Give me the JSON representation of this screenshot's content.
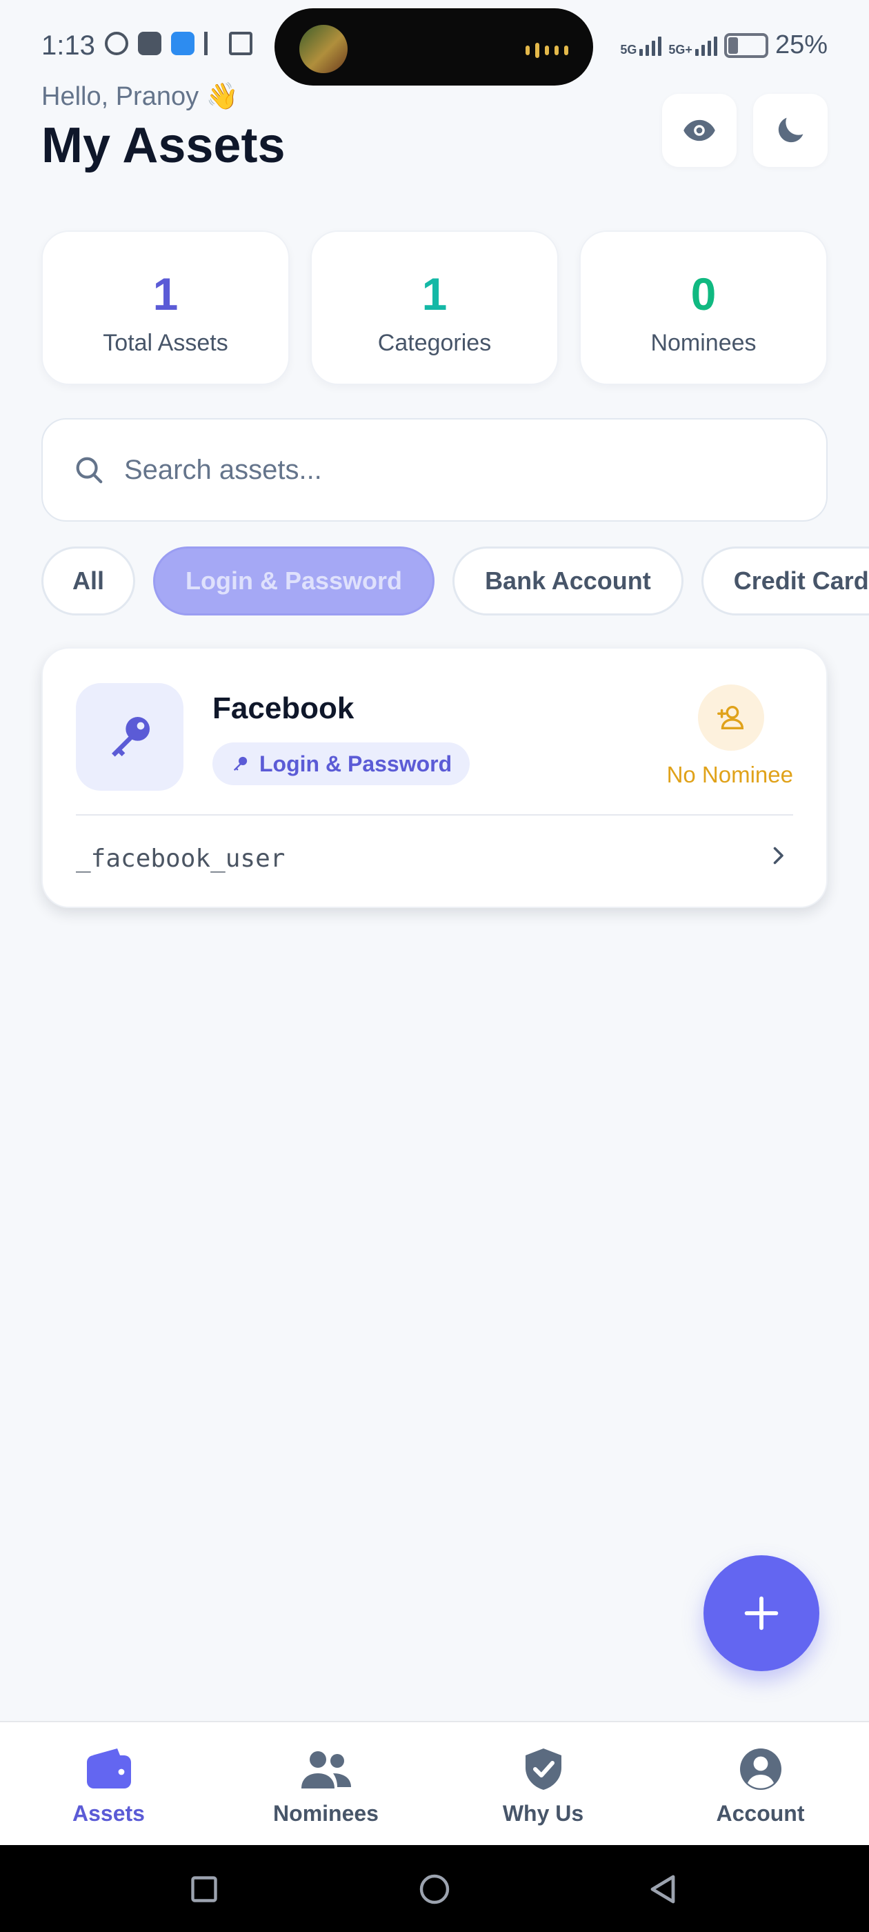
{
  "status_bar": {
    "time": "1:13",
    "network_1": "5G",
    "network_2": "5G+",
    "battery": "25%",
    "notification_icons": [
      "whatsapp-icon",
      "gmail-icon",
      "app-icon",
      "phonepe-icon",
      "mail-icon"
    ]
  },
  "header": {
    "greeting": "Hello, Pranoy 👋",
    "title": "My Assets",
    "actions": [
      "eye-icon",
      "moon-icon"
    ]
  },
  "stats": [
    {
      "value": "1",
      "label": "Total Assets",
      "color": "#5b5bd6"
    },
    {
      "value": "1",
      "label": "Categories",
      "color": "#14b8a6"
    },
    {
      "value": "0",
      "label": "Nominees",
      "color": "#10b981"
    }
  ],
  "search": {
    "placeholder": "Search assets...",
    "value": ""
  },
  "filters": {
    "chips": [
      "All",
      "Login & Password",
      "Bank Account",
      "Credit Card"
    ],
    "selected": "Login & Password"
  },
  "assets": [
    {
      "name": "Facebook",
      "category": "Login & Password",
      "nominee_status": "No Nominee",
      "username": "_facebook_user",
      "icon": "key-icon"
    }
  ],
  "fab": {
    "icon": "plus-icon"
  },
  "bottom_nav": {
    "items": [
      {
        "label": "Assets",
        "icon": "wallet-icon",
        "active": true
      },
      {
        "label": "Nominees",
        "icon": "users-icon",
        "active": false
      },
      {
        "label": "Why Us",
        "icon": "shield-check-icon",
        "active": false
      },
      {
        "label": "Account",
        "icon": "user-circle-icon",
        "active": false
      }
    ]
  },
  "colors": {
    "accent": "#6366f1",
    "accent_text": "#5b5bd6",
    "warning": "#e0a21a",
    "background": "#f6f8fb"
  }
}
